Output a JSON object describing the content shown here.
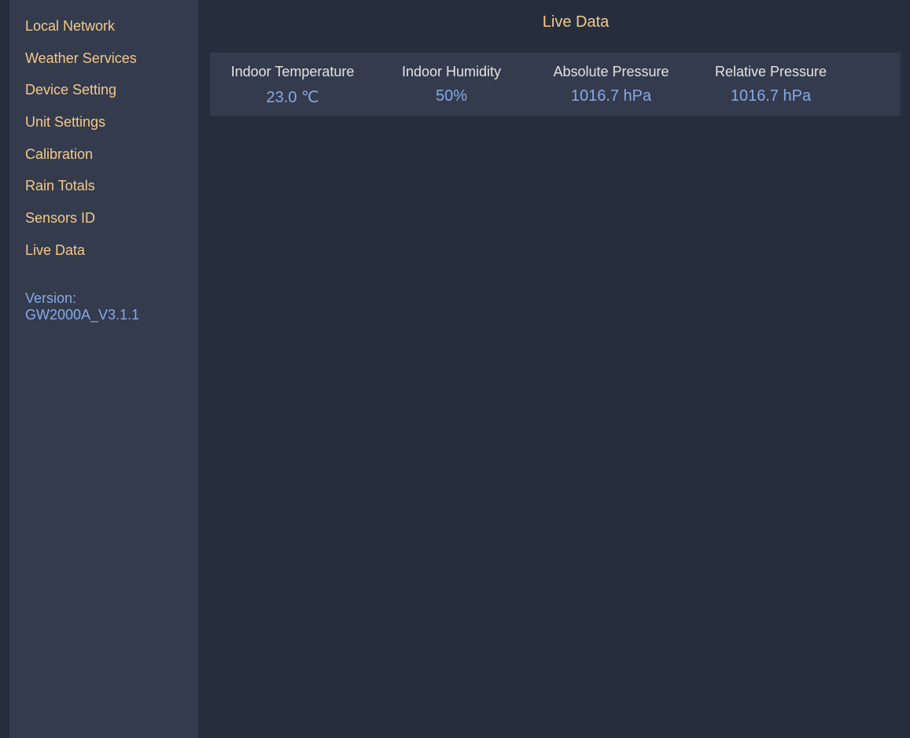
{
  "sidebar": {
    "items": [
      {
        "label": "Local Network"
      },
      {
        "label": "Weather Services"
      },
      {
        "label": "Device Setting"
      },
      {
        "label": "Unit Settings"
      },
      {
        "label": "Calibration"
      },
      {
        "label": "Rain Totals"
      },
      {
        "label": "Sensors ID"
      },
      {
        "label": "Live Data"
      }
    ],
    "version_label": "Version:",
    "version_value": "GW2000A_V3.1.1"
  },
  "main": {
    "title": "Live Data",
    "readings": [
      {
        "label": "Indoor Temperature",
        "value": "23.0 ℃"
      },
      {
        "label": "Indoor Humidity",
        "value": "50%"
      },
      {
        "label": "Absolute Pressure",
        "value": "1016.7 hPa"
      },
      {
        "label": "Relative Pressure",
        "value": "1016.7 hPa"
      }
    ]
  },
  "colors": {
    "background": "#262e3e",
    "sidebar": "#343b4d",
    "nav_text": "#f3c98a",
    "value_text": "#86a9e8",
    "label_text": "#e3e3e3"
  }
}
